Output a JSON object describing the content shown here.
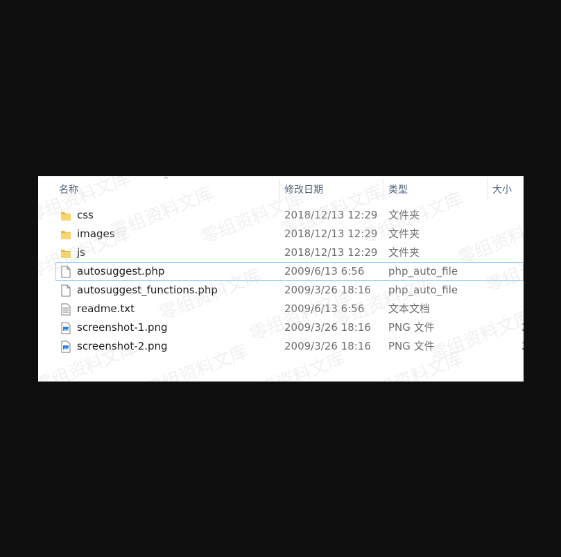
{
  "columns": {
    "name": "名称",
    "date": "修改日期",
    "type": "类型",
    "size": "大小"
  },
  "files": [
    {
      "name": "css",
      "date": "2018/12/13 12:29",
      "type": "文件夹",
      "icon": "folder-icon",
      "size": ""
    },
    {
      "name": "images",
      "date": "2018/12/13 12:29",
      "type": "文件夹",
      "icon": "folder-icon",
      "size": ""
    },
    {
      "name": "js",
      "date": "2018/12/13 12:29",
      "type": "文件夹",
      "icon": "folder-icon",
      "size": ""
    },
    {
      "name": "autosuggest.php",
      "date": "2009/6/13 6:56",
      "type": "php_auto_file",
      "icon": "php-file-icon",
      "size": ""
    },
    {
      "name": "autosuggest_functions.php",
      "date": "2009/3/26 18:16",
      "type": "php_auto_file",
      "icon": "php-file-icon",
      "size": ""
    },
    {
      "name": "readme.txt",
      "date": "2009/6/13 6:56",
      "type": "文本文档",
      "icon": "text-file-icon",
      "size": ""
    },
    {
      "name": "screenshot-1.png",
      "date": "2009/3/26 18:16",
      "type": "PNG 文件",
      "icon": "image-file-icon",
      "size": "2"
    },
    {
      "name": "screenshot-2.png",
      "date": "2009/3/26 18:16",
      "type": "PNG 文件",
      "icon": "image-file-icon",
      "size": "2"
    }
  ],
  "watermark": "零组资料文库",
  "colors": {
    "background": "#0f0f0f",
    "panel": "#ffffff",
    "header_text": "#4c607a",
    "selection_border": "#99d1ff",
    "folder": "#f2c45a"
  }
}
